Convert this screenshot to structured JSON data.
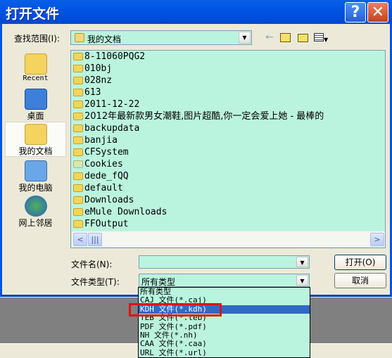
{
  "window": {
    "title": "打开文件",
    "help_label": "?",
    "close_label": "✕"
  },
  "lookin": {
    "label": "查找范围(I):",
    "value": "我的文档",
    "icon": "my-documents-icon"
  },
  "toolbar": {
    "back": "←",
    "up": "up-folder-icon",
    "new_folder": "new-folder-icon",
    "view_menu": "view-menu-icon"
  },
  "places": [
    {
      "label": "Recent",
      "icon": "recent-folder-icon"
    },
    {
      "label": "桌面",
      "icon": "desktop-icon"
    },
    {
      "label": "我的文档",
      "icon": "my-documents-icon",
      "selected": true
    },
    {
      "label": "我的电脑",
      "icon": "my-computer-icon"
    },
    {
      "label": "网上邻居",
      "icon": "network-places-icon"
    }
  ],
  "files": [
    "8-11060PQG2",
    "010bj",
    "028nz",
    "613",
    "2011-12-22",
    "2012年最新款男女潮鞋,图片超酷,你一定会爱上她  -  最棒的",
    "backupdata",
    "banjia",
    "CFSystem",
    "Cookies",
    "dede_fQQ",
    "default",
    "Downloads",
    "eMule Downloads",
    "FFOutput"
  ],
  "filename": {
    "label": "文件名(N):",
    "value": ""
  },
  "filetype": {
    "label": "文件类型(T):",
    "value": "所有类型",
    "options": [
      "所有类型",
      "CAJ 文件(*.caj)",
      "KDH 文件(*.kdh)",
      "TEB 文件(*.teb)",
      "PDF 文件(*.pdf)",
      "NH 文件(*.nh)",
      "CAA 文件(*.caa)",
      "URL 文件(*.url)"
    ],
    "highlighted_index": 2
  },
  "buttons": {
    "open": "打开(O)",
    "cancel": "取消"
  },
  "colors": {
    "titlebar": "#0054e3",
    "list_bg": "#bbf4de",
    "highlight": "#316ac5",
    "annotation": "#e01010"
  }
}
